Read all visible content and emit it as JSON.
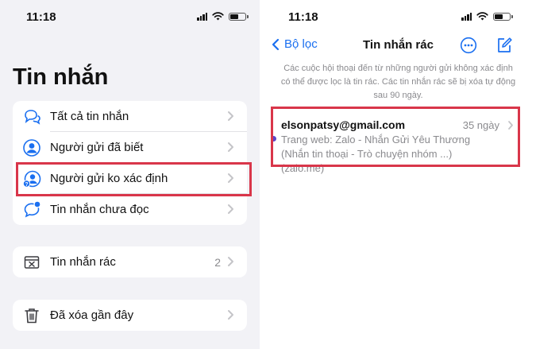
{
  "left_screen": {
    "status_time": "11:18",
    "title": "Tin nhắn",
    "groups": [
      {
        "items": [
          {
            "label": "Tất cả tin nhắn",
            "icon": "chat-bubbles-icon"
          },
          {
            "label": "Người gửi đã biết",
            "icon": "person-circle-icon"
          },
          {
            "label": "Người gửi ko xác định",
            "icon": "unknown-person-icon"
          },
          {
            "label": "Tin nhắn chưa đọc",
            "icon": "unread-bubble-icon"
          }
        ]
      },
      {
        "items": [
          {
            "label": "Tin nhắn rác",
            "icon": "junk-tray-icon",
            "count": "2"
          }
        ]
      },
      {
        "items": [
          {
            "label": "Đã xóa gần đây",
            "icon": "trash-icon"
          }
        ]
      }
    ]
  },
  "right_screen": {
    "status_time": "11:18",
    "nav": {
      "back_label": "Bộ lọc",
      "title": "Tin nhắn rác"
    },
    "info_text": "Các cuộc hội thoại đến từ những người gửi không xác định có thể được lọc là tin rác. Các tin nhắn rác sẽ bị xóa tự động sau 90 ngày.",
    "messages": [
      {
        "sender": "elsonpatsy@gmail.com",
        "date": "35 ngày",
        "preview": "Trang web: Zalo - Nhắn Gửi Yêu Thương (Nhắn tin thoại - Trò chuyện nhóm ...) (zalo.me)",
        "unread": true
      }
    ]
  },
  "colors": {
    "accent": "#1a6ff0",
    "highlight": "#d9364a",
    "background": "#f2f2f6",
    "unread_dot": "#5a45c8",
    "secondary_text": "#8a8a8e"
  }
}
